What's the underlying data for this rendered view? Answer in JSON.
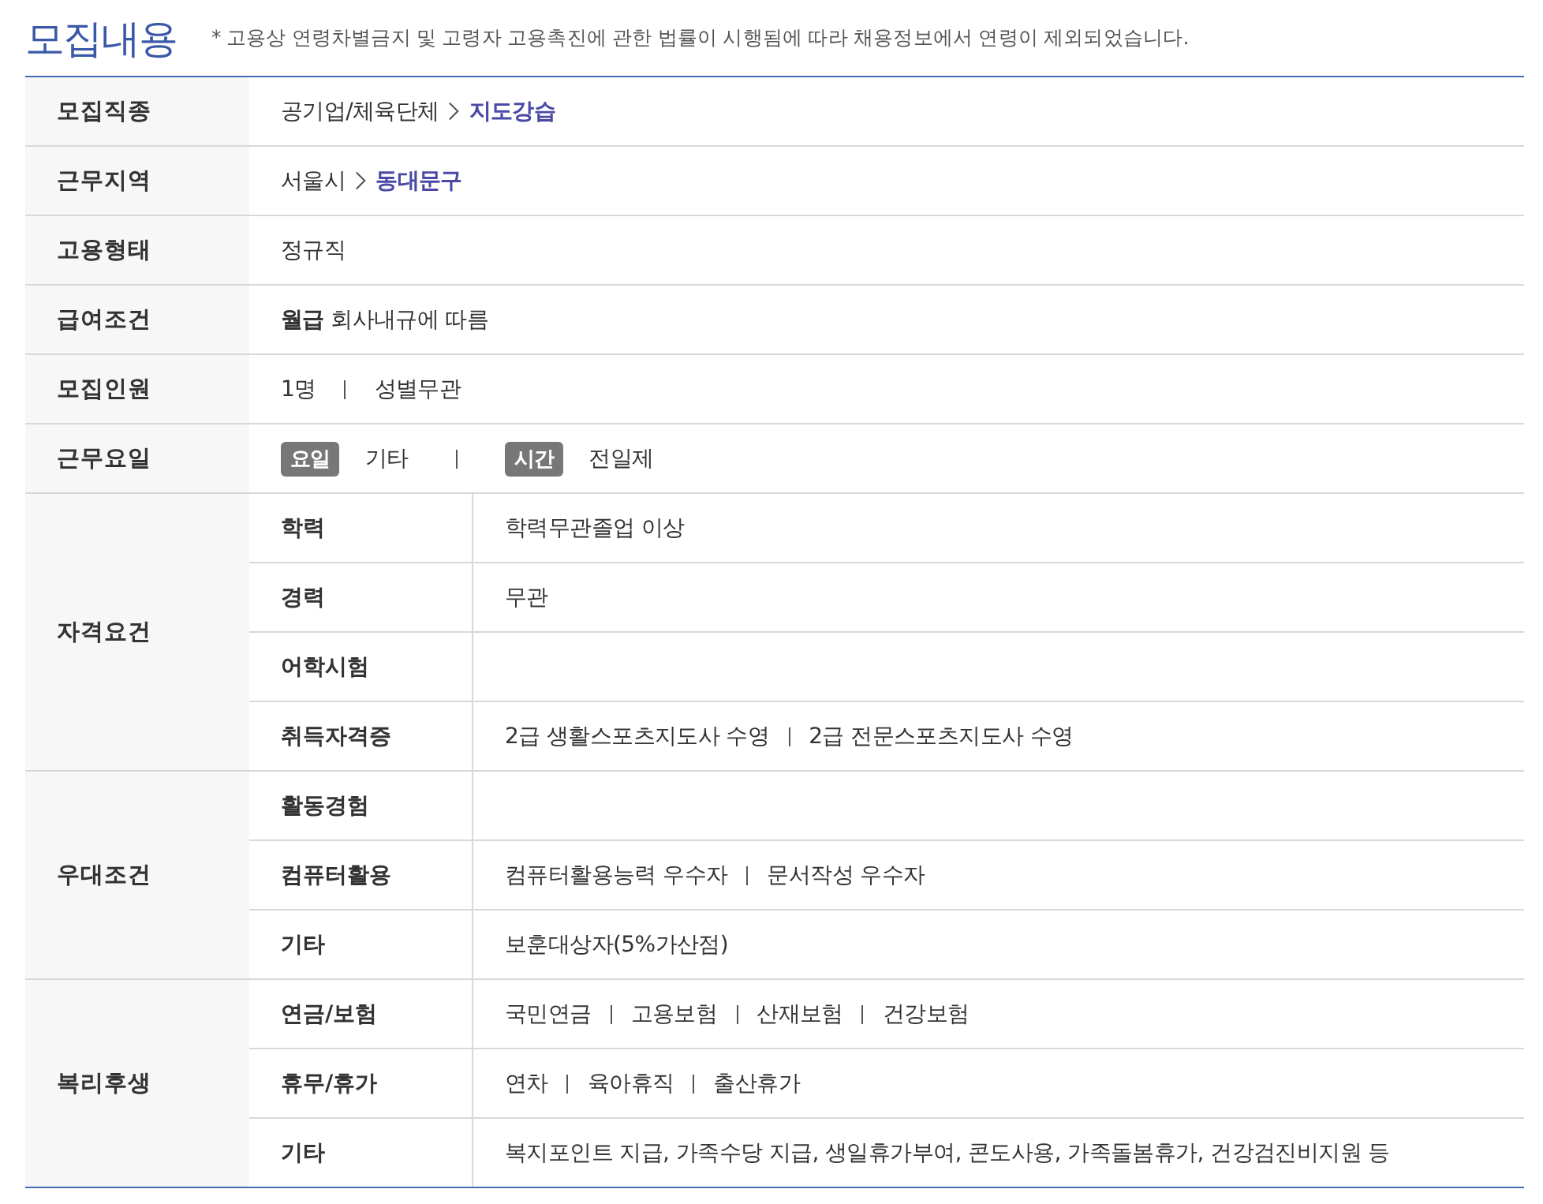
{
  "title": "모집내용",
  "notice": "* 고용상 연령차별금지 및 고령자 고용촉진에 관한 법률이 시행됨에 따라 채용정보에서 연령이 제외되었습니다.",
  "rows": [
    {
      "kind": "path",
      "label": "모집직종",
      "parts": [
        "공기업/체육단체",
        "지도강습"
      ]
    },
    {
      "kind": "path",
      "label": "근무지역",
      "parts": [
        "서울시",
        "동대문구"
      ]
    },
    {
      "kind": "text",
      "label": "고용형태",
      "value": "정규직"
    },
    {
      "kind": "text",
      "label": "급여조건",
      "value": "**월급** 회사내규에 따름"
    },
    {
      "kind": "list",
      "label": "모집인원",
      "items": [
        "1명",
        "성별무관"
      ]
    },
    {
      "kind": "tags",
      "label": "근무요일",
      "pairs": [
        {
          "tag": "요일",
          "value": "기타"
        },
        {
          "tag": "시간",
          "value": "전일제"
        }
      ]
    },
    {
      "kind": "group",
      "label": "자격요건",
      "children": [
        {
          "label": "학력",
          "items": [
            "학력무관졸업 이상"
          ]
        },
        {
          "label": "경력",
          "items": [
            "무관"
          ]
        },
        {
          "label": "어학시험"
        },
        {
          "label": "취득자격증",
          "items": [
            "2급 생활스포츠지도사 수영",
            "2급 전문스포츠지도사 수영"
          ]
        }
      ]
    },
    {
      "kind": "group",
      "label": "우대조건",
      "children": [
        {
          "label": "활동경험"
        },
        {
          "label": "컴퓨터활용",
          "items": [
            "컴퓨터활용능력 우수자",
            "문서작성 우수자"
          ]
        },
        {
          "label": "기타",
          "items": [
            "보훈대상자(5%가산점)"
          ]
        }
      ]
    },
    {
      "kind": "group",
      "label": "복리후생",
      "children": [
        {
          "label": "연금/보험",
          "items": [
            "국민연금",
            "고용보험",
            "산재보험",
            "건강보험"
          ]
        },
        {
          "label": "휴무/휴가",
          "items": [
            "연차",
            "육아휴직",
            "출산휴가"
          ]
        },
        {
          "label": "기타",
          "items": [
            "복지포인트 지급, 가족수당 지급, 생일휴가부여, 콘도사용, 가족돌봄휴가, 건강검진비지원 등"
          ]
        }
      ]
    }
  ]
}
